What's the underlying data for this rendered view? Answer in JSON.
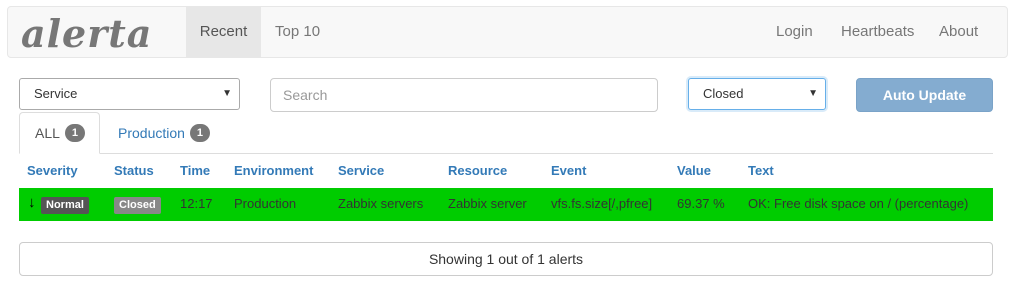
{
  "nav": {
    "brand": "alerta",
    "items": [
      {
        "label": "Recent",
        "active": true
      },
      {
        "label": "Top 10",
        "active": false
      }
    ],
    "right_items": [
      {
        "label": "Login"
      },
      {
        "label": "Heartbeats"
      },
      {
        "label": "About"
      }
    ]
  },
  "filters": {
    "service_select": "Service",
    "search_placeholder": "Search",
    "status_select": "Closed",
    "auto_update_label": "Auto Update"
  },
  "tabs": [
    {
      "label": "ALL",
      "count": "1",
      "active": true
    },
    {
      "label": "Production",
      "count": "1",
      "active": false
    }
  ],
  "table": {
    "columns": [
      "Severity",
      "Status",
      "Time",
      "Environment",
      "Service",
      "Resource",
      "Event",
      "Value",
      "Text"
    ],
    "rows": [
      {
        "severity_arrow": "🠗",
        "severity": "Normal",
        "status": "Closed",
        "time": "12:17",
        "environment": "Production",
        "service": "Zabbix servers",
        "resource": "Zabbix server",
        "event": "vfs.fs.size[/,pfree]",
        "value": "69.37 %",
        "text": "OK: Free disk space on / (percentage)",
        "row_color": "#00cc00"
      }
    ]
  },
  "footer": {
    "summary": "Showing 1 out of 1 alerts"
  },
  "colors": {
    "accent": "#337ab7",
    "normal_row": "#00cc00",
    "auto_update": "#84acd0"
  }
}
